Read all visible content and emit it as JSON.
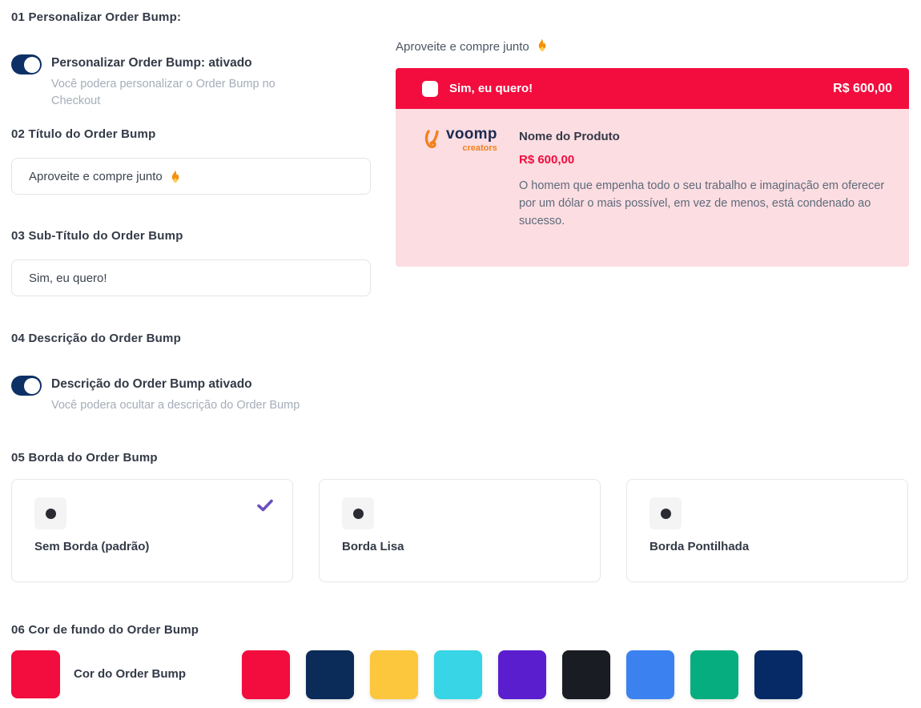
{
  "colors": {
    "accent_red": "#f20d3e",
    "preview_pink": "#fbdde2",
    "toggle_navy": "#0d3166",
    "check_purple": "#6a4fc1"
  },
  "icons": {
    "flame": "🔥",
    "check": "✔",
    "voomp_swirl": "voomp-swirl-icon"
  },
  "sections": {
    "s1": {
      "title": "01 Personalizar Order Bump:",
      "toggle_label": "Personalizar Order Bump: ativado",
      "toggle_hint": "Você podera personalizar o Order Bump no Checkout",
      "toggle_state": "on"
    },
    "s2": {
      "title": "02 Título do Order Bump",
      "input_value": "Aproveite e compre junto"
    },
    "s3": {
      "title": "03 Sub-Título do Order Bump",
      "input_value": "Sim, eu quero!"
    },
    "s4": {
      "title": "04 Descrição do Order Bump",
      "toggle_label": "Descrição do Order Bump ativado",
      "toggle_hint": "Você podera ocultar a descrição do Order Bump",
      "toggle_state": "on"
    },
    "s5": {
      "title": "05 Borda do Order Bump",
      "options": [
        {
          "label": "Sem Borda (padrão)",
          "selected": true
        },
        {
          "label": "Borda Lisa",
          "selected": false
        },
        {
          "label": "Borda Pontilhada",
          "selected": false
        }
      ]
    },
    "s6": {
      "title": "06 Cor de fundo do Order Bump",
      "selected_label": "Cor do Order Bump",
      "selected_color": "#f20d3e",
      "palette": [
        "#f20d3e",
        "#0b2b58",
        "#fcc63d",
        "#38d5e6",
        "#5a1ece",
        "#191c23",
        "#3b82f0",
        "#06ad7e",
        "#052a66"
      ]
    }
  },
  "preview": {
    "title": "Aproveite e compre junto",
    "header": {
      "label": "Sim, eu quero!",
      "price": "R$ 600,00",
      "checkbox_checked": false
    },
    "body": {
      "logo_name": "voomp",
      "logo_sub": "creators",
      "product_name": "Nome do Produto",
      "price": "R$ 600,00",
      "description": "O homem que empenha todo o seu trabalho e imaginação em oferecer por um dólar o mais possível, em vez de menos, está condenado ao sucesso."
    }
  }
}
